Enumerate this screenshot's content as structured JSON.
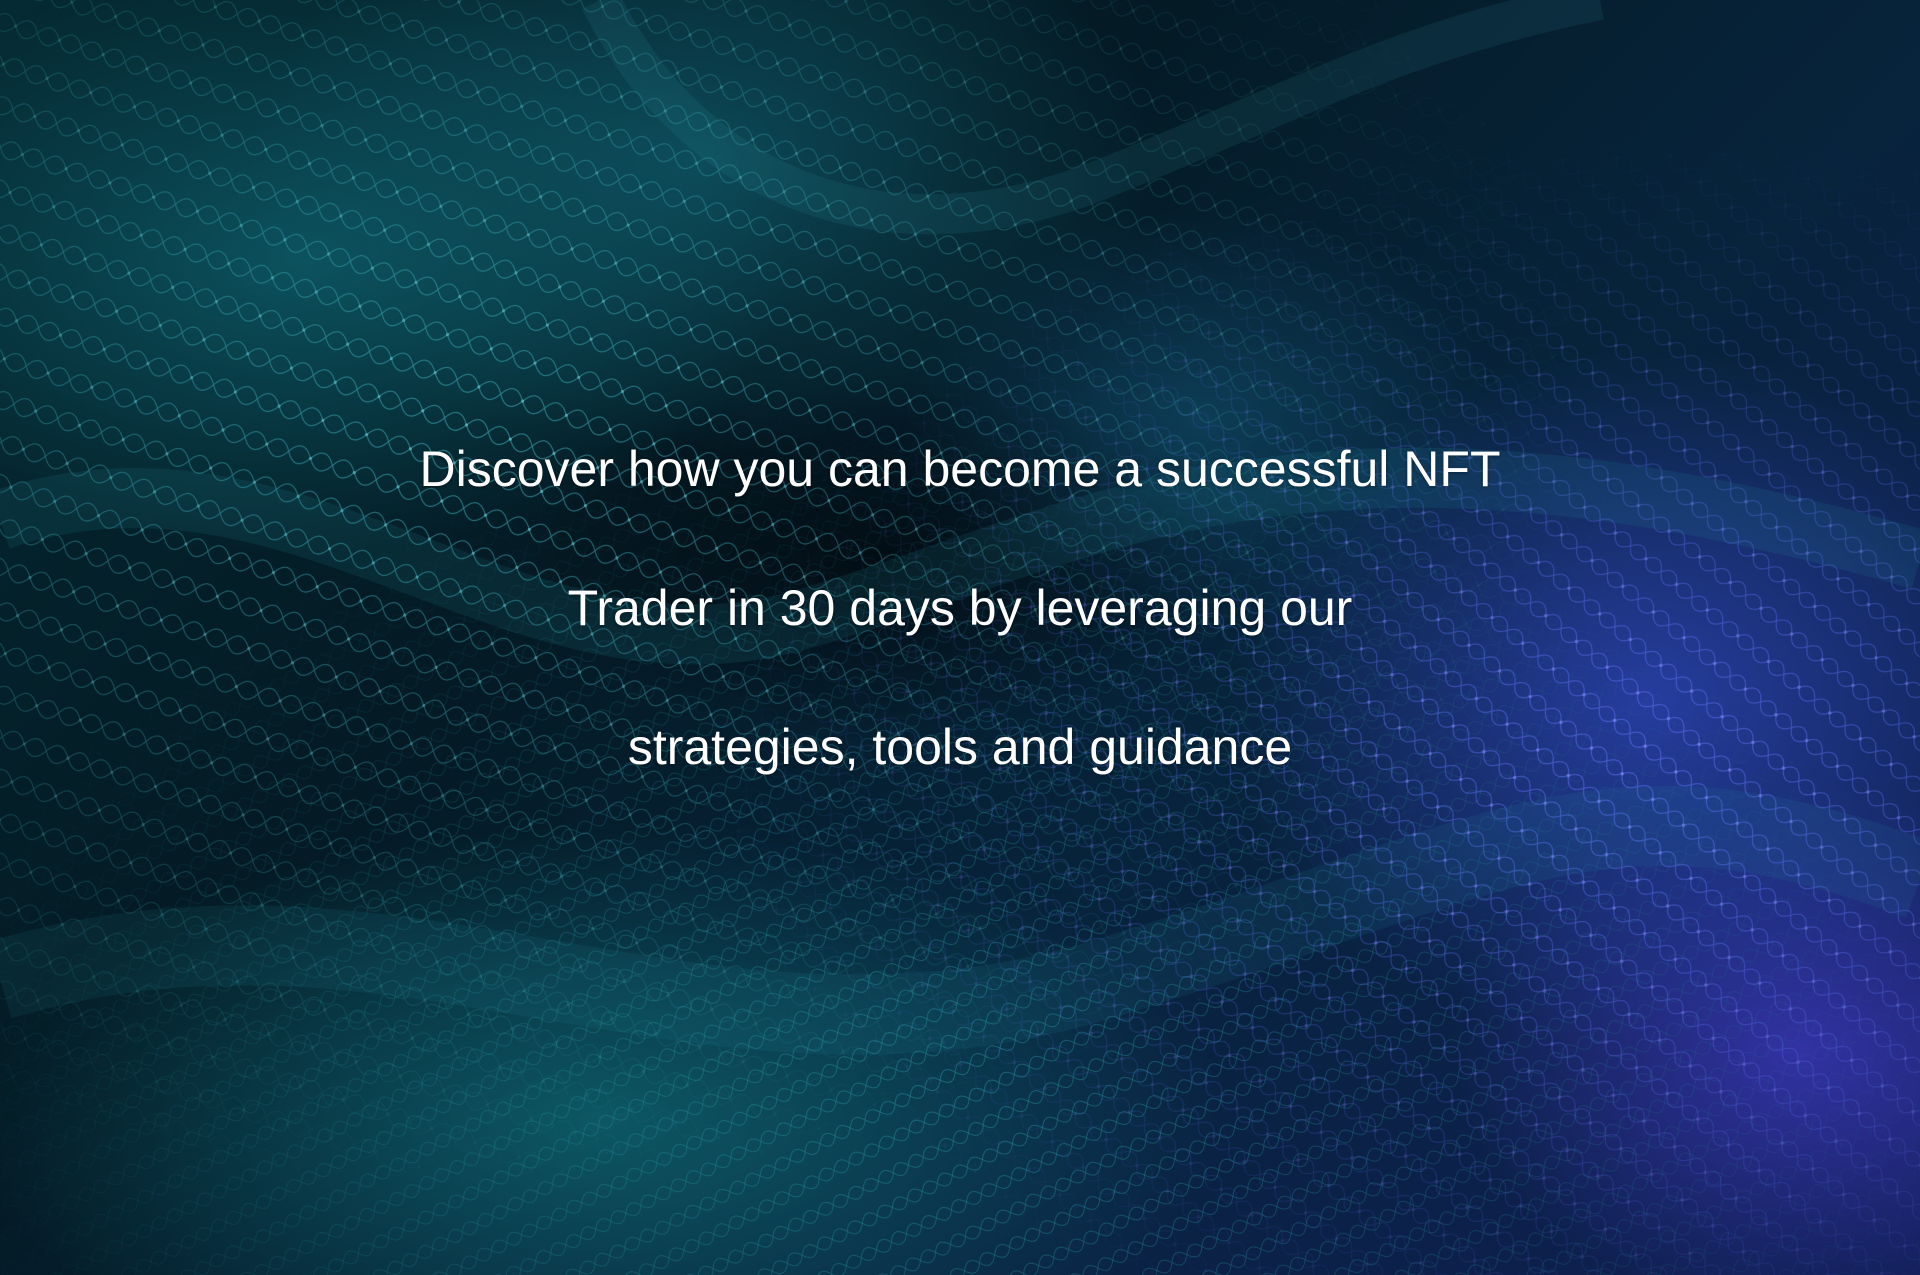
{
  "hero": {
    "background_image": "teal-blue-net-mesh-photo",
    "colors": {
      "teal": "#0e6e78",
      "deep": "#041a24",
      "violet": "#3c46d2",
      "text": "#ffffff"
    },
    "headline_lines": [
      "Discover how you can become a successful NFT",
      "Trader in 30 days by leveraging our",
      "strategies, tools and guidance"
    ]
  }
}
